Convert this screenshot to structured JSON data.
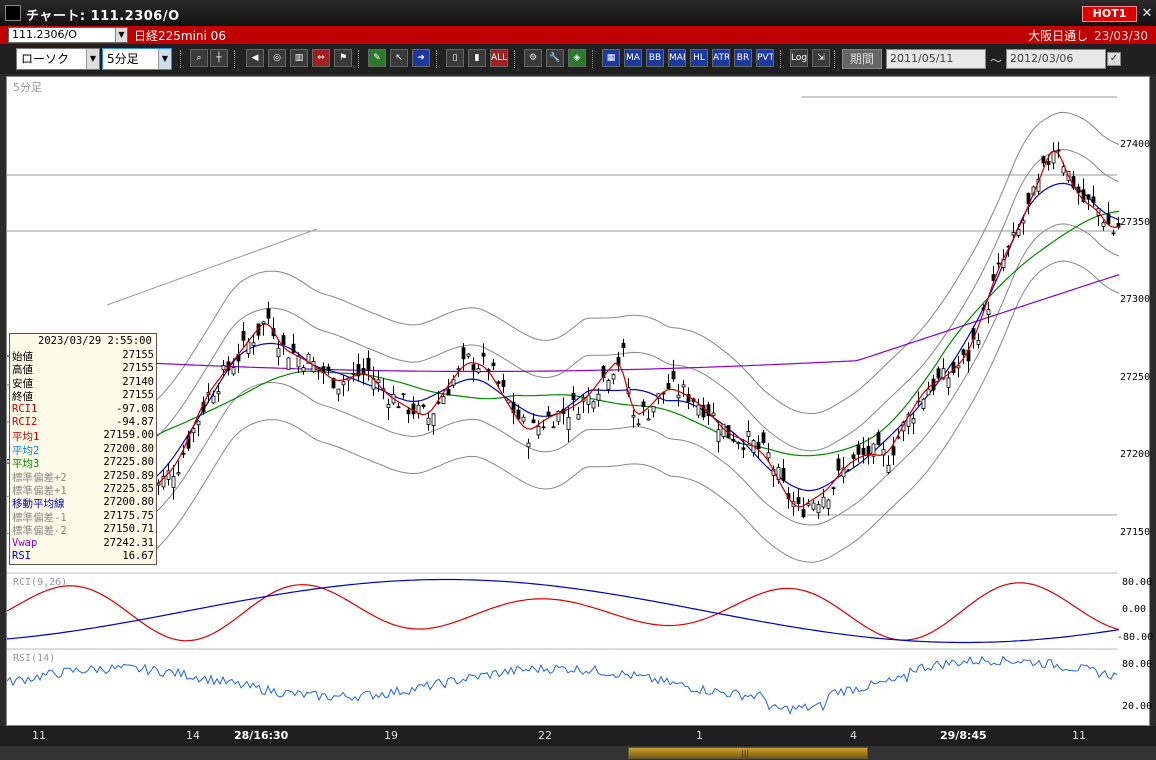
{
  "window": {
    "title": "チャート: 111.2306/O",
    "hot_label": "HOT1",
    "close_label": "✕"
  },
  "infobar": {
    "code_value": "111.2306/O",
    "product_name": "日経225mini 06",
    "session_label": "大阪日通し",
    "session_date": "23/03/30"
  },
  "toolbar": {
    "chart_type": "ローソク",
    "timeframe": "5分足",
    "period_label": "期間",
    "date_from": "2011/05/11",
    "date_to": "2012/03/06",
    "tilde": "〜",
    "icons": [
      "zoom-in",
      "crosshair",
      "scroll",
      "cursor",
      "volume",
      "line",
      "trendline",
      "arrow",
      "signal",
      "brush",
      "palette",
      "settings",
      "grid",
      "ma",
      "bb",
      "mae",
      "hl",
      "atr",
      "rsi",
      "pvt",
      "log",
      "export"
    ],
    "icon_texts": {
      "ma": "MA",
      "bb": "BB",
      "mae": "MAE",
      "hl": "HL",
      "atr": "ATR",
      "rsi": "BR",
      "pvt": "PVT",
      "log": "Log",
      "all": "ALL"
    }
  },
  "chart": {
    "period_label": "5分足",
    "price_axis": [
      "27400",
      "27350",
      "27300",
      "27250",
      "27200",
      "27150"
    ],
    "rci_label": "RCI(9,26)",
    "rci_axis": [
      "80.00",
      "0.00",
      "-80.00"
    ],
    "rsi_label": "RSI(14)",
    "rsi_axis": [
      "80.00",
      "20.00"
    ],
    "x_ticks": [
      "11",
      "14",
      "28/16:30",
      "19",
      "22",
      "1",
      "4",
      "29/8:45",
      "11"
    ]
  },
  "data_panel": {
    "timestamp": "2023/03/29  2:55:00",
    "rows": [
      {
        "label": "始値",
        "value": "27155",
        "color": "#000000"
      },
      {
        "label": "高値",
        "value": "27155",
        "color": "#000000"
      },
      {
        "label": "安値",
        "value": "27140",
        "color": "#000000"
      },
      {
        "label": "終値",
        "value": "27155",
        "color": "#000000"
      },
      {
        "label": "RCI1",
        "value": "-97.08",
        "color": "#cc0000"
      },
      {
        "label": "RCI2",
        "value": "-94.87",
        "color": "#cc0000"
      },
      {
        "label": "平均1",
        "value": "27159.00",
        "color": "#cc0000"
      },
      {
        "label": "平均2",
        "value": "27200.80",
        "color": "#0088cc"
      },
      {
        "label": "平均3",
        "value": "27225.80",
        "color": "#008800"
      },
      {
        "label": "標準偏差+2",
        "value": "27250.89",
        "color": "#888888"
      },
      {
        "label": "標準偏差+1",
        "value": "27225.85",
        "color": "#888888"
      },
      {
        "label": "移動平均線",
        "value": "27200.80",
        "color": "#0000cc"
      },
      {
        "label": "標準偏差-1",
        "value": "27175.75",
        "color": "#888888"
      },
      {
        "label": "標準偏差-2",
        "value": "27150.71",
        "color": "#888888"
      },
      {
        "label": "Vwap",
        "value": "27242.31",
        "color": "#9900cc"
      },
      {
        "label": "RSI",
        "value": "16.67",
        "color": "#0000cc"
      }
    ]
  },
  "colors": {
    "candle_up": "#ffffff",
    "candle_down": "#000000",
    "ma1": "#cc0000",
    "ma2": "#0000cc",
    "ma3": "#008800",
    "band": "#888888",
    "vwap": "#8800cc",
    "rci_fast": "#dd0000",
    "rci_slow": "#0000cc",
    "rsi": "#2266dd"
  }
}
